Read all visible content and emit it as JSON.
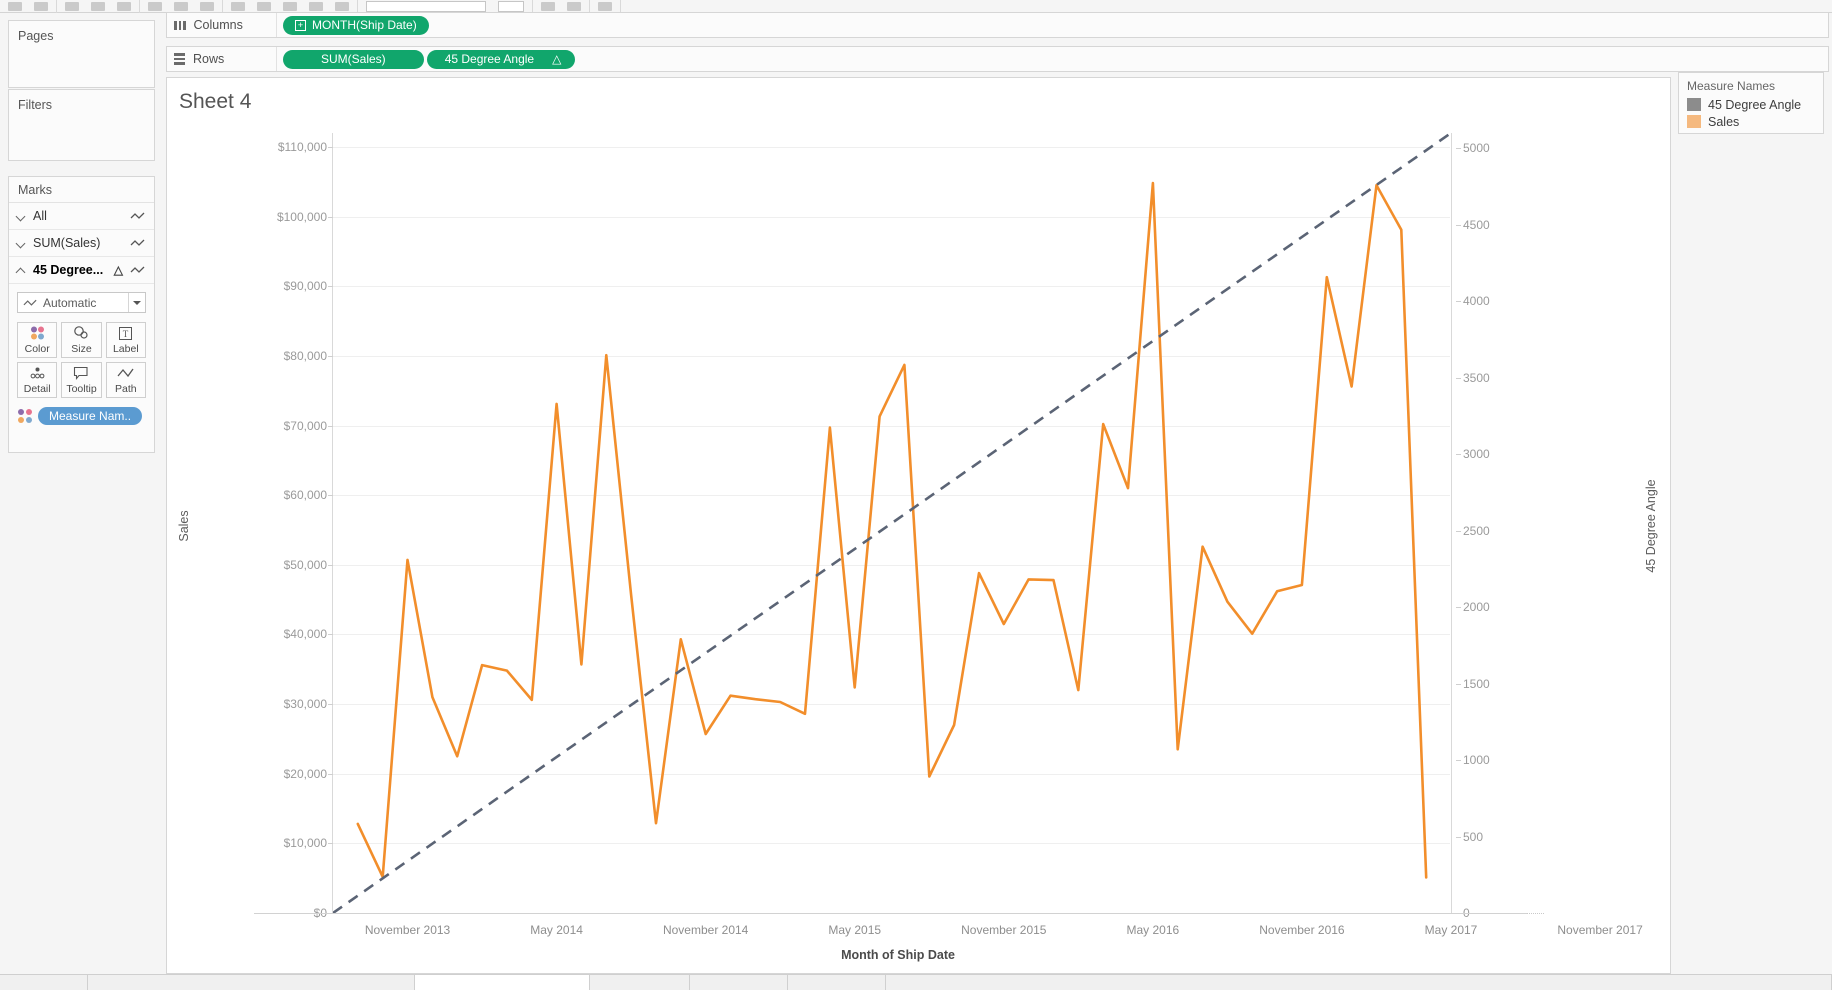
{
  "app": {
    "sheet_title": "Sheet 4"
  },
  "left_panel": {
    "pages_label": "Pages",
    "filters_label": "Filters",
    "marks_label": "Marks",
    "mark_cards": [
      {
        "label": "All",
        "expanded": true,
        "has_triangle": false,
        "type_icon": "line-icon"
      },
      {
        "label": "SUM(Sales)",
        "expanded": true,
        "has_triangle": false,
        "type_icon": "line-icon"
      },
      {
        "label": "45 Degree...",
        "expanded": false,
        "has_triangle": true,
        "type_icon": "line-icon"
      }
    ],
    "mark_type": "Automatic",
    "mark_buttons": [
      {
        "label": "Color",
        "icon": "color-dots-icon"
      },
      {
        "label": "Size",
        "icon": "size-circles-icon"
      },
      {
        "label": "Label",
        "icon": "label-text-icon"
      },
      {
        "label": "Detail",
        "icon": "detail-dots-icon"
      },
      {
        "label": "Tooltip",
        "icon": "tooltip-bubble-icon"
      },
      {
        "label": "Path",
        "icon": "path-line-icon"
      }
    ],
    "measure_names_pill": "Measure Nam..",
    "measure_names_pill_color": "#5b9bd1"
  },
  "shelves": {
    "columns_label": "Columns",
    "rows_label": "Rows",
    "columns_pills": [
      {
        "text": "MONTH(Ship Date)",
        "prefix_icon": "plus-box-icon",
        "suffix_icon": "",
        "color": "#11a66c"
      }
    ],
    "rows_pills": [
      {
        "text": "SUM(Sales)",
        "prefix_icon": "",
        "suffix_icon": "",
        "color": "#11a66c"
      },
      {
        "text": "45 Degree Angle",
        "prefix_icon": "",
        "suffix_icon": "△",
        "color": "#11a66c"
      }
    ]
  },
  "legend": {
    "title": "Measure Names",
    "items": [
      {
        "label": "45 Degree Angle",
        "color": "#8c8c8c"
      },
      {
        "label": "Sales",
        "color": "#f5b97f"
      }
    ]
  },
  "chart_data": {
    "type": "line",
    "title": "Sheet 4",
    "xlabel": "Month of Ship Date",
    "ylabel": "Sales",
    "y2label": "45 Degree Angle",
    "grid": true,
    "legend_position": "right",
    "y_ticks": [
      "$0",
      "$10,000",
      "$20,000",
      "$30,000",
      "$40,000",
      "$50,000",
      "$60,000",
      "$70,000",
      "$80,000",
      "$90,000",
      "$100,000",
      "$110,000"
    ],
    "y_tick_values": [
      0,
      10000,
      20000,
      30000,
      40000,
      50000,
      60000,
      70000,
      80000,
      90000,
      100000,
      110000
    ],
    "ylim": [
      0,
      112000
    ],
    "y2_ticks": [
      "0",
      "500",
      "1000",
      "1500",
      "2000",
      "2500",
      "3000",
      "3500",
      "4000",
      "4500",
      "5000"
    ],
    "y2_tick_values": [
      0,
      500,
      1000,
      1500,
      2000,
      2500,
      3000,
      3500,
      4000,
      4500,
      5000
    ],
    "y2lim": [
      0,
      5100
    ],
    "x_ticks": [
      "November 2013",
      "May 2014",
      "November 2014",
      "May 2015",
      "November 2015",
      "May 2016",
      "November 2016",
      "May 2017",
      "November 2017"
    ],
    "x_tick_index": [
      2,
      8,
      14,
      20,
      26,
      32,
      38,
      44,
      50
    ],
    "x_months": [
      "September 2013",
      "October 2013",
      "November 2013",
      "December 2013",
      "January 2014",
      "February 2014",
      "March 2014",
      "April 2014",
      "May 2014",
      "June 2014",
      "July 2014",
      "August 2014",
      "September 2014",
      "October 2014",
      "November 2014",
      "December 2014",
      "January 2015",
      "February 2015",
      "March 2015",
      "April 2015",
      "May 2015",
      "June 2015",
      "July 2015",
      "August 2015",
      "September 2015",
      "October 2015",
      "November 2015",
      "December 2015",
      "January 2016",
      "February 2016",
      "March 2016",
      "April 2016",
      "May 2016",
      "June 2016",
      "July 2016",
      "August 2016",
      "September 2016",
      "October 2016",
      "November 2016",
      "December 2016",
      "January 2017",
      "February 2017",
      "March 2017",
      "April 2017",
      "May 2017",
      "June 2017",
      "July 2017",
      "August 2017",
      "September 2017",
      "October 2017",
      "November 2017",
      "December 2017",
      "January 2018"
    ],
    "series": [
      {
        "name": "Sales",
        "axis": "left",
        "color": "#f28e2b",
        "style": "solid",
        "values": [
          12800,
          5200,
          50700,
          31000,
          22500,
          35600,
          34800,
          30600,
          73100,
          35700,
          80100,
          45700,
          12900,
          39300,
          25700,
          31200,
          30700,
          30300,
          28600,
          69700,
          32400,
          71300,
          78700,
          19600,
          27000,
          48800,
          41500,
          47900,
          47800,
          32000,
          70200,
          61000,
          104800,
          23500,
          52600,
          44700,
          40100,
          46200,
          47100,
          91300,
          75600,
          104500,
          98100,
          5100
        ]
      },
      {
        "name": "45 Degree Angle",
        "axis": "right",
        "color": "#5b6475",
        "style": "dashed",
        "values_start": 0,
        "values_end": 5100,
        "description": "Straight dashed reference line rising linearly from 0 at the left edge to about 5100 at the right edge"
      }
    ]
  },
  "colors": {
    "sales_line": "#f28e2b",
    "reference_line": "#5b6475",
    "pill_green": "#11a66c",
    "measure_pill_blue": "#5b9bd1"
  }
}
